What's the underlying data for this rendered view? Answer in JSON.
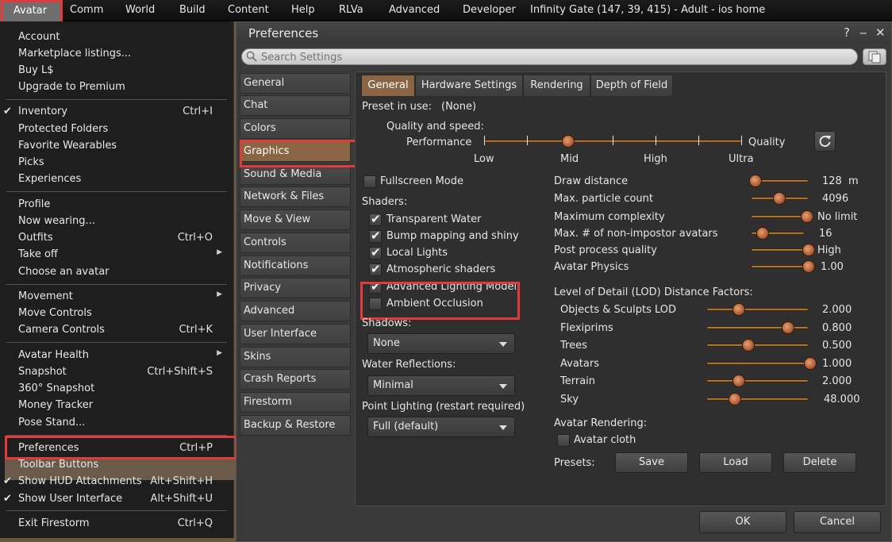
{
  "menubar": {
    "items": [
      "Avatar",
      "Comm",
      "World",
      "Build",
      "Content",
      "Help",
      "RLVa",
      "Advanced",
      "Developer"
    ],
    "location": "Infinity Gate (147, 39, 415) - Adult - ios home"
  },
  "avatar_menu": {
    "account": "Account",
    "marketplace": "Marketplace listings...",
    "buy": "Buy L$",
    "upgrade": "Upgrade to Premium",
    "inventory": "Inventory",
    "inventory_sc": "Ctrl+I",
    "protected": "Protected Folders",
    "wearables": "Favorite Wearables",
    "picks": "Picks",
    "experiences": "Experiences",
    "profile": "Profile",
    "now_wearing": "Now wearing...",
    "outfits": "Outfits",
    "outfits_sc": "Ctrl+O",
    "take_off": "Take off",
    "choose_avatar": "Choose an avatar",
    "movement": "Movement",
    "move_controls": "Move Controls",
    "camera_controls": "Camera Controls",
    "camera_sc": "Ctrl+K",
    "avatar_health": "Avatar Health",
    "snapshot": "Snapshot",
    "snapshot_sc": "Ctrl+Shift+S",
    "snapshot360": "360° Snapshot",
    "money_tracker": "Money Tracker",
    "pose_stand": "Pose Stand...",
    "preferences": "Preferences",
    "preferences_sc": "Ctrl+P",
    "toolbar_buttons": "Toolbar Buttons",
    "show_hud": "Show HUD Attachments",
    "show_hud_sc": "Alt+Shift+H",
    "show_ui": "Show User Interface",
    "show_ui_sc": "Alt+Shift+U",
    "exit": "Exit Firestorm",
    "exit_sc": "Ctrl+Q"
  },
  "prefs": {
    "title": "Preferences",
    "help": "?",
    "minimize": "‒",
    "close": "✕",
    "search_placeholder": "Search Settings",
    "categories": [
      "General",
      "Chat",
      "Colors",
      "Graphics",
      "Sound & Media",
      "Network & Files",
      "Move & View",
      "Controls",
      "Notifications",
      "Privacy",
      "Advanced",
      "User Interface",
      "Skins",
      "Crash Reports",
      "Firestorm",
      "Backup & Restore"
    ],
    "tabs": [
      "General",
      "Hardware Settings",
      "Rendering",
      "Depth of Field"
    ],
    "preset_label": "Preset in use:",
    "preset_value": "(None)",
    "quality_speed": "Quality and speed:",
    "performance": "Performance",
    "quality": "Quality",
    "quality_level_fraction": 0.2,
    "quality_ticks": [
      "Low",
      "Mid",
      "High",
      "Ultra"
    ],
    "fullscreen": "Fullscreen Mode",
    "shaders_label": "Shaders:",
    "shaders": [
      {
        "label": "Transparent Water",
        "checked": true
      },
      {
        "label": "Bump mapping and shiny",
        "checked": true
      },
      {
        "label": "Local Lights",
        "checked": true
      },
      {
        "label": "Atmospheric shaders",
        "checked": true
      },
      {
        "label": "Advanced Lighting Model",
        "checked": true
      },
      {
        "label": "Ambient Occlusion",
        "checked": false
      }
    ],
    "shadows_label": "Shadows:",
    "shadows_value": "None",
    "water_label": "Water Reflections:",
    "water_value": "Minimal",
    "point_label": "Point Lighting (restart required)",
    "point_value": "Full (default)",
    "sliders": [
      {
        "label": "Draw distance",
        "value": "128",
        "unit": "m",
        "fraction": 0.0
      },
      {
        "label": "Max. particle count",
        "value": "4096",
        "fraction": 0.5
      },
      {
        "label": "Maximum complexity",
        "value": "No limit",
        "fraction": 1.0
      },
      {
        "label": "Max. # of non-impostor avatars",
        "value": "16",
        "fraction": 0.2
      },
      {
        "label": "Post process quality",
        "value": "High",
        "fraction": 1.0
      },
      {
        "label": "Avatar Physics",
        "value": "1.00",
        "fraction": 1.0
      }
    ],
    "lod_label": "Level of Detail (LOD) Distance Factors:",
    "lod": [
      {
        "label": "Objects & Sculpts LOD",
        "value": "2.000",
        "fraction": 0.3
      },
      {
        "label": "Flexiprims",
        "value": "0.800",
        "fraction": 0.8
      },
      {
        "label": "Trees",
        "value": "0.500",
        "fraction": 0.4
      },
      {
        "label": "Avatars",
        "value": "1.000",
        "fraction": 1.0
      },
      {
        "label": "Terrain",
        "value": "2.000",
        "fraction": 0.3
      },
      {
        "label": "Sky",
        "value": "48.000",
        "fraction": 0.25
      }
    ],
    "avatar_rendering": "Avatar Rendering:",
    "avatar_cloth": "Avatar cloth",
    "presets_label": "Presets:",
    "save": "Save",
    "load": "Load",
    "delete": "Delete",
    "ok": "OK",
    "cancel": "Cancel"
  }
}
